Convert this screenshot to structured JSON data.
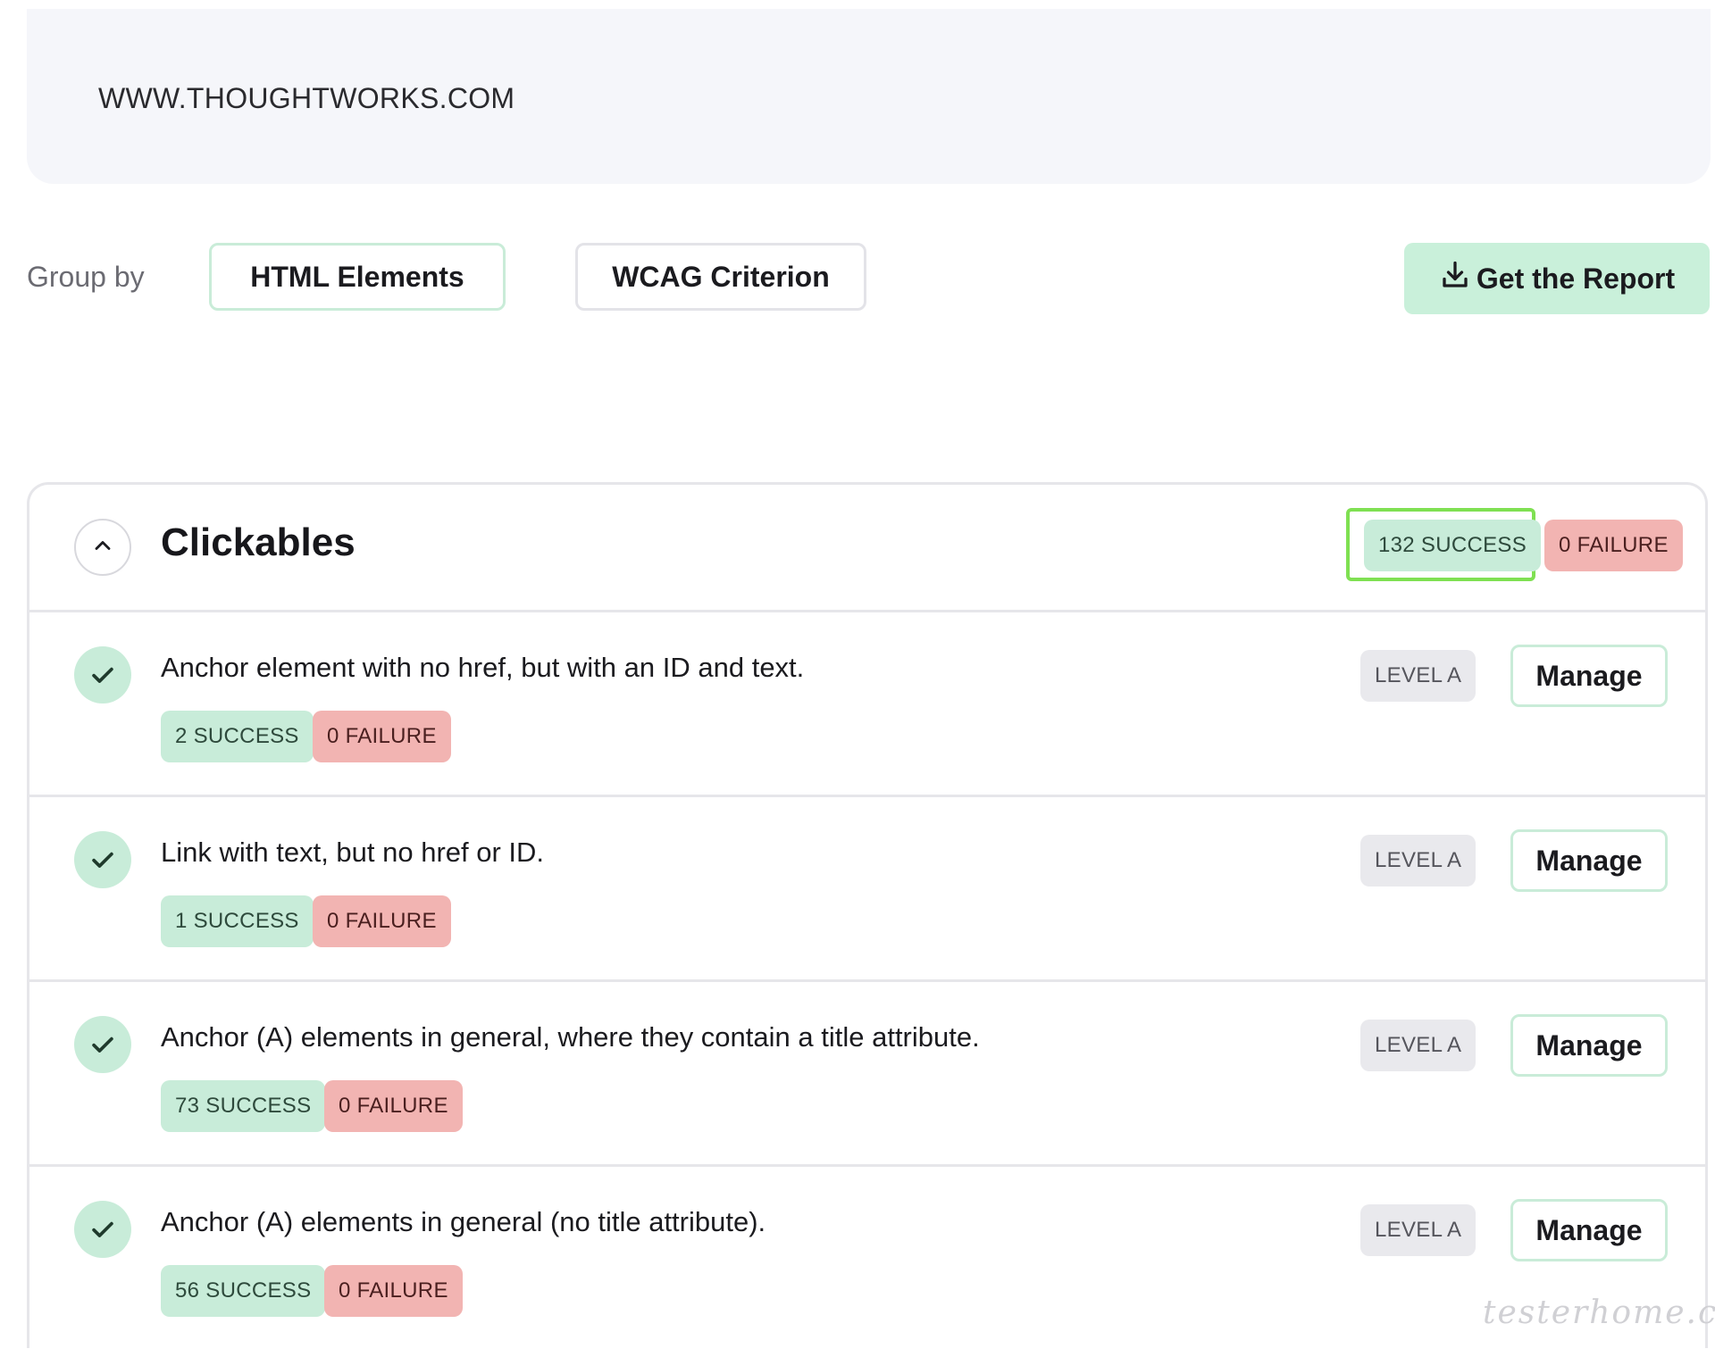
{
  "url": "WWW.THOUGHTWORKS.COM",
  "group_by": {
    "label": "Group by",
    "options": [
      "HTML Elements",
      "WCAG Criterion"
    ],
    "selected": "HTML Elements"
  },
  "report_button": {
    "label": "Get the Report",
    "icon": "download-icon"
  },
  "section": {
    "title": "Clickables",
    "success": "132 SUCCESS",
    "failure": "0 FAILURE",
    "rows": [
      {
        "title": "Anchor element with no href, but with an ID and text.",
        "success": "2 SUCCESS",
        "failure": "0 FAILURE",
        "level": "LEVEL A",
        "action": "Manage"
      },
      {
        "title": "Link with text, but no href or ID.",
        "success": "1 SUCCESS",
        "failure": "0 FAILURE",
        "level": "LEVEL A",
        "action": "Manage"
      },
      {
        "title": "Anchor (A) elements in general, where they contain a title attribute.",
        "success": "73 SUCCESS",
        "failure": "0 FAILURE",
        "level": "LEVEL A",
        "action": "Manage"
      },
      {
        "title": "Anchor (A) elements in general (no title attribute).",
        "success": "56 SUCCESS",
        "failure": "0 FAILURE",
        "level": "LEVEL A",
        "action": "Manage"
      }
    ]
  },
  "watermark": "testerhome.com",
  "colors": {
    "success_bg": "#c8ecd9",
    "failure_bg": "#f2b4b2",
    "highlight": "#7fe052",
    "report_bg": "#c9f0da"
  }
}
